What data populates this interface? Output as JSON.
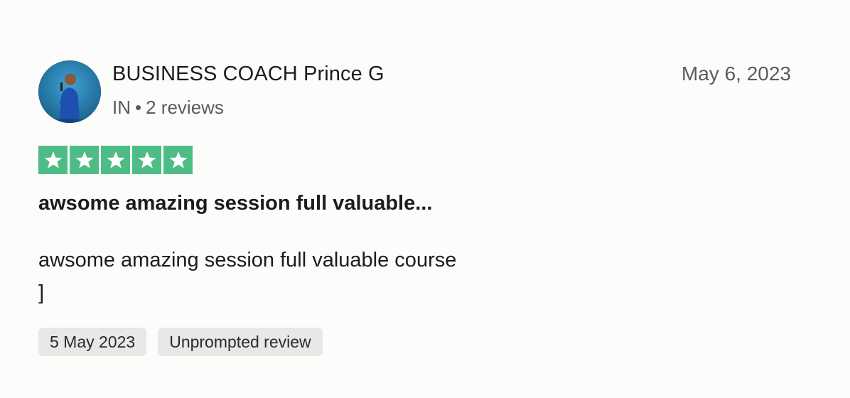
{
  "reviewer": {
    "name": "BUSINESS COACH Prince G",
    "country": "IN",
    "separator": "•",
    "review_count": "2 reviews"
  },
  "review": {
    "date": "May 6, 2023",
    "rating": 5,
    "rating_max": 5,
    "star_color": "#4ebd85",
    "title": "awsome amazing session full valuable...",
    "body": "awsome amazing session full valuable course\n]",
    "tags": [
      {
        "label": "5 May 2023"
      },
      {
        "label": "Unprompted review"
      }
    ]
  }
}
